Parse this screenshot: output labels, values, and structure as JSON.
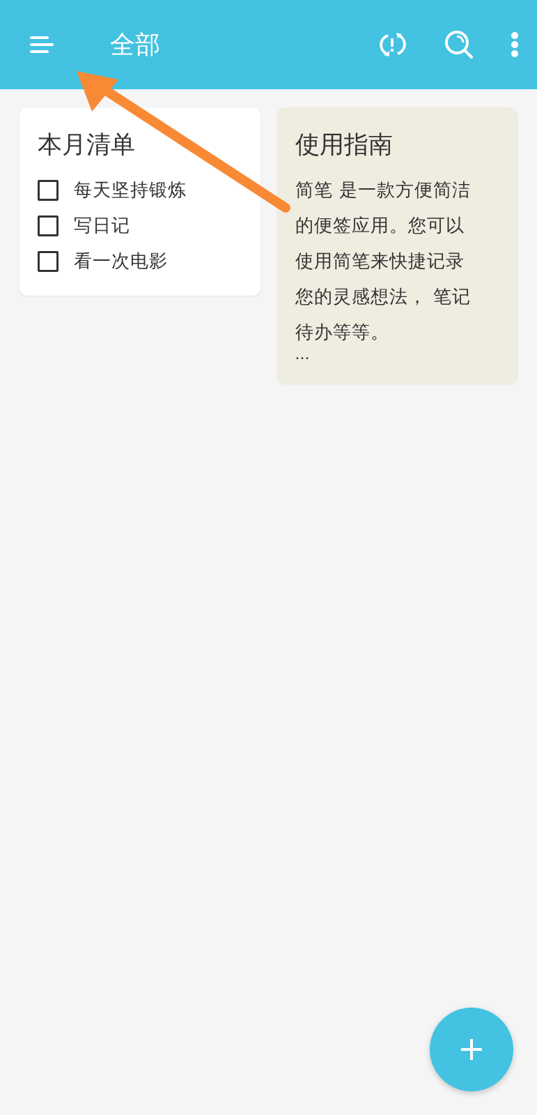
{
  "app_bar": {
    "title": "全部"
  },
  "notes": [
    {
      "kind": "checklist",
      "title": "本月清单",
      "items": [
        {
          "label": "每天坚持锻炼",
          "checked": false
        },
        {
          "label": "写日记",
          "checked": false
        },
        {
          "label": "看一次电影",
          "checked": false
        }
      ]
    },
    {
      "kind": "text",
      "title": "使用指南",
      "body_lines": [
        "简笔 是一款方便简洁",
        "的便签应用。您可以",
        "使用简笔来快捷记录",
        "您的灵感想法， 笔记",
        "待办等等。"
      ],
      "more": "···"
    }
  ],
  "annotation": {
    "kind": "arrow"
  }
}
